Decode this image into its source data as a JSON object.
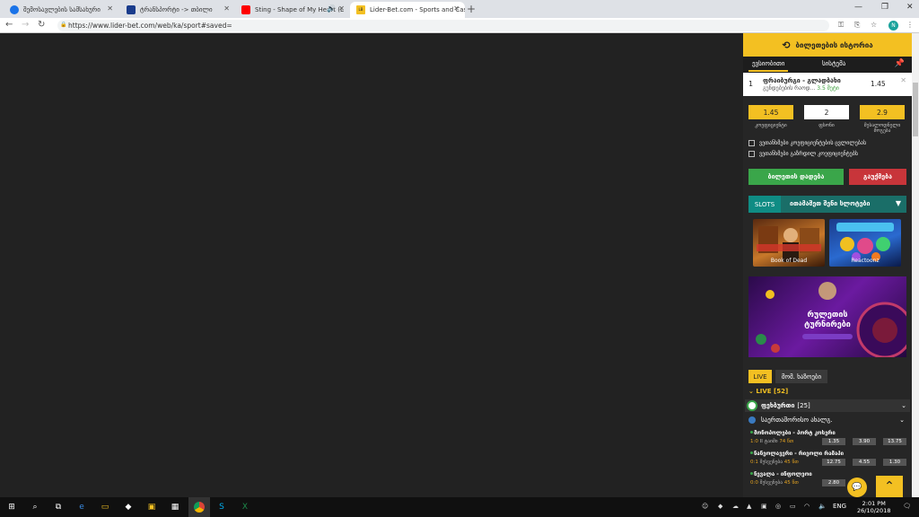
{
  "browser": {
    "tabs": [
      {
        "label": "შემოსავლების სამსახური",
        "color": "#1a73e8"
      },
      {
        "label": "ტრანსპორტი -> თბილი",
        "color": "#1a3c8c"
      },
      {
        "label": "Sting - Shape of My Heart (L",
        "color": "#ff0000"
      },
      {
        "label": "Lider-Bet.com - Sports and Casi",
        "color": "#f3c022",
        "icon_text": "LB"
      }
    ],
    "new_tab": "+",
    "window_controls": [
      "—",
      "❐",
      "✕"
    ],
    "url": "https://www.lider-bet.com/web/ka/sport#saved=",
    "profile_initial": "N"
  },
  "betslip": {
    "history_label": "ბილეთების ისტორია",
    "tabs": [
      "ევსიობითი",
      "სისტემა"
    ],
    "bet": {
      "index": "1",
      "match": "ფრაიბურგი - გლადბახი",
      "market": "გუნდებების რაოდ...",
      "selection": "3.5 მეტი",
      "odd": "1.45"
    },
    "fields": [
      {
        "value": "1.45",
        "label": "კოეფიციენტი"
      },
      {
        "value": "2",
        "label": "ფსონი"
      },
      {
        "value": "2.9",
        "label": "მესალოდნელი მოგება"
      }
    ],
    "checkboxes": [
      "ვეთანხმები კოეფიციენტების ცვლილებას",
      "ვეთანხმები გაზრდილ კოეფიციენტებს"
    ],
    "place_bet": "ბილეთის დადება",
    "clear": "გაუქმება"
  },
  "slots": {
    "tag": "SLOTS",
    "title": "ითამაშეთ შენი სლოტები",
    "games": [
      {
        "name": "Book of Dead"
      },
      {
        "name": "Reactoonz"
      }
    ],
    "banner_title": "რულეთის ტურნირები"
  },
  "live": {
    "tabs": [
      "LIVE",
      "მომ. ხაზოები"
    ],
    "header": "LIVE",
    "count": "[52]",
    "sport": "ფეხბურთი",
    "sport_count": "[25]",
    "league": "საერთაშორისო ახალგ.",
    "events": [
      {
        "name": "მონოპოლები - პორტ კოსერი",
        "score": "1:0",
        "period": "II ტაიმი",
        "minute": "74 წთ",
        "odds": [
          "1.35",
          "3.90",
          "13.75"
        ]
      },
      {
        "name": "ნანეოლავერი - რიეოლი რამაპი",
        "score": "0:1",
        "period": "შესვენება",
        "minute": "45 წთ",
        "odds": [
          "12.75",
          "4.55",
          "1.30"
        ]
      },
      {
        "name": "ნევალა - ინფოლეოი",
        "score": "0:0",
        "period": "შესვენება",
        "minute": "45 წთ",
        "odds": [
          "2.80",
          "",
          ""
        ]
      }
    ]
  },
  "taskbar": {
    "time": "2:01 PM",
    "date": "26/10/2018",
    "lang": "ENG"
  }
}
